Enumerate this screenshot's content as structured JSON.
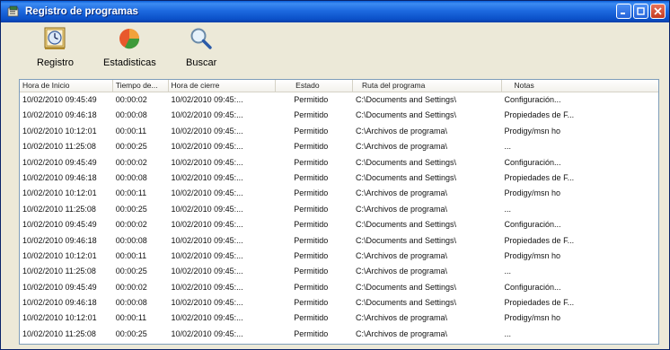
{
  "window": {
    "title": "Registro de programas"
  },
  "toolbar": {
    "buttons": [
      {
        "label": "Registro",
        "icon": "clock-icon"
      },
      {
        "label": "Estadisticas",
        "icon": "pie-chart-icon"
      },
      {
        "label": "Buscar",
        "icon": "magnifier-icon"
      }
    ]
  },
  "table": {
    "columns": [
      "Hora de Inicio",
      "Tiempo de...",
      "Hora de cierre",
      "Estado",
      "Ruta del programa",
      "Notas"
    ],
    "rows": [
      [
        "10/02/2010 09:45:49",
        "00:00:02",
        "10/02/2010 09:45:...",
        "Permitido",
        "C:\\Documents and Settings\\",
        "Configuración..."
      ],
      [
        "10/02/2010 09:46:18",
        "00:00:08",
        "10/02/2010 09:45:...",
        "Permitido",
        "C:\\Documents and Settings\\",
        "Propiedades de F..."
      ],
      [
        "10/02/2010 10:12:01",
        "00:00:11",
        "10/02/2010 09:45:...",
        "Permitido",
        "C:\\Archivos de programa\\",
        "Prodigy/msn ho"
      ],
      [
        "10/02/2010 11:25:08",
        "00:00:25",
        "10/02/2010 09:45:...",
        "Permitido",
        "C:\\Archivos de programa\\",
        "..."
      ],
      [
        "10/02/2010 09:45:49",
        "00:00:02",
        "10/02/2010 09:45:...",
        "Permitido",
        "C:\\Documents and Settings\\",
        "Configuración..."
      ],
      [
        "10/02/2010 09:46:18",
        "00:00:08",
        "10/02/2010 09:45:...",
        "Permitido",
        "C:\\Documents and Settings\\",
        "Propiedades de F..."
      ],
      [
        "10/02/2010 10:12:01",
        "00:00:11",
        "10/02/2010 09:45:...",
        "Permitido",
        "C:\\Archivos de programa\\",
        "Prodigy/msn ho"
      ],
      [
        "10/02/2010 11:25:08",
        "00:00:25",
        "10/02/2010 09:45:...",
        "Permitido",
        "C:\\Archivos de programa\\",
        "..."
      ],
      [
        "10/02/2010 09:45:49",
        "00:00:02",
        "10/02/2010 09:45:...",
        "Permitido",
        "C:\\Documents and Settings\\",
        "Configuración..."
      ],
      [
        "10/02/2010 09:46:18",
        "00:00:08",
        "10/02/2010 09:45:...",
        "Permitido",
        "C:\\Documents and Settings\\",
        "Propiedades de F..."
      ],
      [
        "10/02/2010 10:12:01",
        "00:00:11",
        "10/02/2010 09:45:...",
        "Permitido",
        "C:\\Archivos de programa\\",
        "Prodigy/msn ho"
      ],
      [
        "10/02/2010 11:25:08",
        "00:00:25",
        "10/02/2010 09:45:...",
        "Permitido",
        "C:\\Archivos de programa\\",
        "..."
      ],
      [
        "10/02/2010 09:45:49",
        "00:00:02",
        "10/02/2010 09:45:...",
        "Permitido",
        "C:\\Documents and Settings\\",
        "Configuración..."
      ],
      [
        "10/02/2010 09:46:18",
        "00:00:08",
        "10/02/2010 09:45:...",
        "Permitido",
        "C:\\Documents and Settings\\",
        "Propiedades de F..."
      ],
      [
        "10/02/2010 10:12:01",
        "00:00:11",
        "10/02/2010 09:45:...",
        "Permitido",
        "C:\\Archivos de programa\\",
        "Prodigy/msn ho"
      ],
      [
        "10/02/2010 11:25:08",
        "00:00:25",
        "10/02/2010 09:45:...",
        "Permitido",
        "C:\\Archivos de programa\\",
        "..."
      ]
    ]
  },
  "colors": {
    "titlebar": "#1d6ae0",
    "window_bg": "#ece9d8",
    "list_border": "#7f9db9"
  }
}
